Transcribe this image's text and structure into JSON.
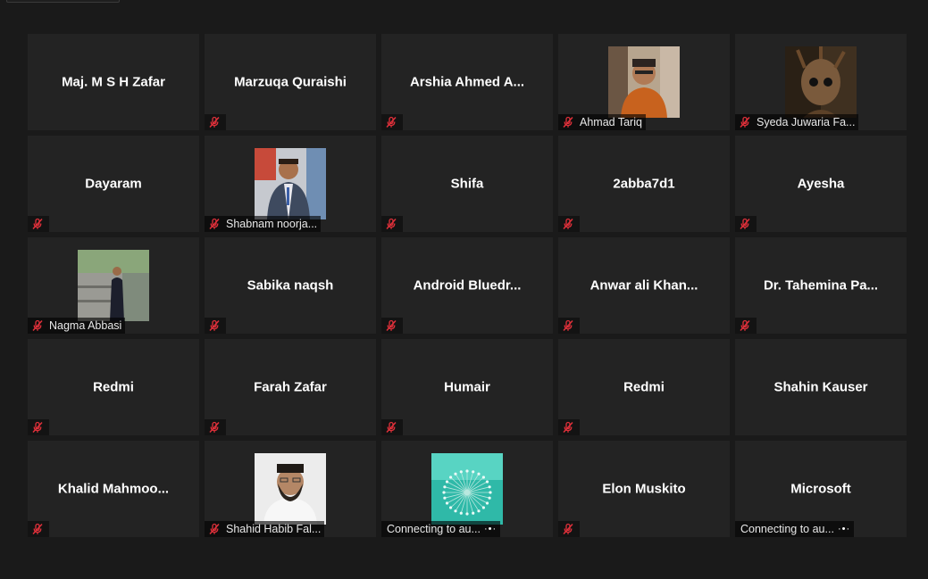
{
  "colors": {
    "tile_bg": "#232323",
    "page_bg": "#1a1a1a",
    "muted_icon": "#e0303a"
  },
  "icons": {
    "muted": "mic-muted-icon",
    "connecting": "more-dots-icon"
  },
  "tiles": [
    {
      "name": "Maj. M S H Zafar",
      "label": "",
      "video": "",
      "status": "muted-header"
    },
    {
      "name": "Marzuqa Quraishi",
      "label": "",
      "video": "",
      "status": "muted"
    },
    {
      "name": "Arshia Ahmed A...",
      "label": "",
      "video": "",
      "status": "muted"
    },
    {
      "name": "",
      "label": "Ahmad Tariq",
      "video": "man-orange",
      "status": "muted"
    },
    {
      "name": "",
      "label": "Syeda Juwaria Fa...",
      "video": "groot",
      "status": "muted"
    },
    {
      "name": "Dayaram",
      "label": "",
      "video": "",
      "status": "muted"
    },
    {
      "name": "",
      "label": "Shabnam noorja...",
      "video": "man-suit",
      "status": "muted"
    },
    {
      "name": "Shifa",
      "label": "",
      "video": "",
      "status": "muted"
    },
    {
      "name": "2abba7d1",
      "label": "",
      "video": "",
      "status": "muted"
    },
    {
      "name": "Ayesha",
      "label": "",
      "video": "",
      "status": "muted"
    },
    {
      "name": "",
      "label": "Nagma Abbasi",
      "video": "woman-stairs",
      "status": "muted"
    },
    {
      "name": "Sabika naqsh",
      "label": "",
      "video": "",
      "status": "muted"
    },
    {
      "name": "Android  Bluedr...",
      "label": "",
      "video": "",
      "status": "muted"
    },
    {
      "name": "Anwar ali Khan...",
      "label": "",
      "video": "",
      "status": "muted"
    },
    {
      "name": "Dr. Tahemina Pa...",
      "label": "",
      "video": "",
      "status": "muted"
    },
    {
      "name": "Redmi",
      "label": "",
      "video": "",
      "status": "muted"
    },
    {
      "name": "Farah Zafar",
      "label": "",
      "video": "",
      "status": "muted"
    },
    {
      "name": "Humair",
      "label": "",
      "video": "",
      "status": "muted"
    },
    {
      "name": "Redmi",
      "label": "",
      "video": "",
      "status": "muted"
    },
    {
      "name": "Shahin Kauser",
      "label": "",
      "video": "",
      "status": "none"
    },
    {
      "name": "Khalid  Mahmoo...",
      "label": "",
      "video": "",
      "status": "muted"
    },
    {
      "name": "",
      "label": "Shahid Habib Fal...",
      "video": "man-beard",
      "status": "muted"
    },
    {
      "name": "",
      "label": "Connecting to au...",
      "video": "dandelion",
      "status": "connecting"
    },
    {
      "name": "Elon Muskito",
      "label": "",
      "video": "",
      "status": "muted"
    },
    {
      "name": "Microsoft",
      "label": "Connecting to au...",
      "video": "",
      "status": "connecting"
    }
  ]
}
